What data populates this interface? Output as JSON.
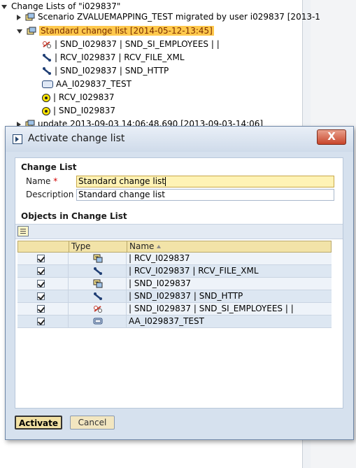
{
  "background": {
    "header": "Change Lists of \"i029837\"",
    "rows": [
      {
        "text": "Scenario ZVALUEMAPPING_TEST migrated by user i029837 [2013-1",
        "expanded": false,
        "icon": "change-list-icon"
      },
      {
        "text": "Standard change list [2014-05-12-13:45]",
        "expanded": true,
        "icon": "change-list-icon",
        "highlighted": true
      },
      {
        "text": "| SND_I029837 | SND_SI_EMPLOYEES |  |",
        "icon": "sender-interface-icon"
      },
      {
        "text": "| RCV_I029837 | RCV_FILE_XML",
        "icon": "channel-icon"
      },
      {
        "text": "| SND_I029837 | SND_HTTP",
        "icon": "channel-icon"
      },
      {
        "text": "AA_I029837_TEST",
        "icon": "rect-object-icon"
      },
      {
        "text": "| RCV_I029837",
        "icon": "yellow-dot-icon"
      },
      {
        "text": "| SND_I029837",
        "icon": "yellow-dot-icon"
      },
      {
        "text": "update 2013-09-03 14:06:48.690 [2013-09-03-14:06]",
        "expanded": false,
        "icon": "change-list-icon"
      }
    ]
  },
  "dialog": {
    "title": "Activate change list",
    "close_label": "X",
    "change_list_section": "Change List",
    "name_label": "Name",
    "required_marker": "*",
    "name_value": "Standard change list",
    "description_label": "Description",
    "description_value": "Standard change list",
    "objects_section": "Objects in Change List",
    "columns": {
      "type": "Type",
      "name": "Name"
    },
    "rows": [
      {
        "checked": true,
        "type_icon": "communication-party-icon",
        "name": "| RCV_I029837"
      },
      {
        "checked": true,
        "type_icon": "channel-icon",
        "name": "| RCV_I029837 | RCV_FILE_XML"
      },
      {
        "checked": true,
        "type_icon": "communication-party-icon",
        "name": "| SND_I029837"
      },
      {
        "checked": true,
        "type_icon": "channel-icon",
        "name": "| SND_I029837 | SND_HTTP"
      },
      {
        "checked": true,
        "type_icon": "sender-interface-icon",
        "name": "| SND_I029837 | SND_SI_EMPLOYEES |  |"
      },
      {
        "checked": true,
        "type_icon": "rect-object-icon",
        "name": "AA_I029837_TEST"
      }
    ],
    "activate_label": "Activate",
    "cancel_label": "Cancel"
  }
}
